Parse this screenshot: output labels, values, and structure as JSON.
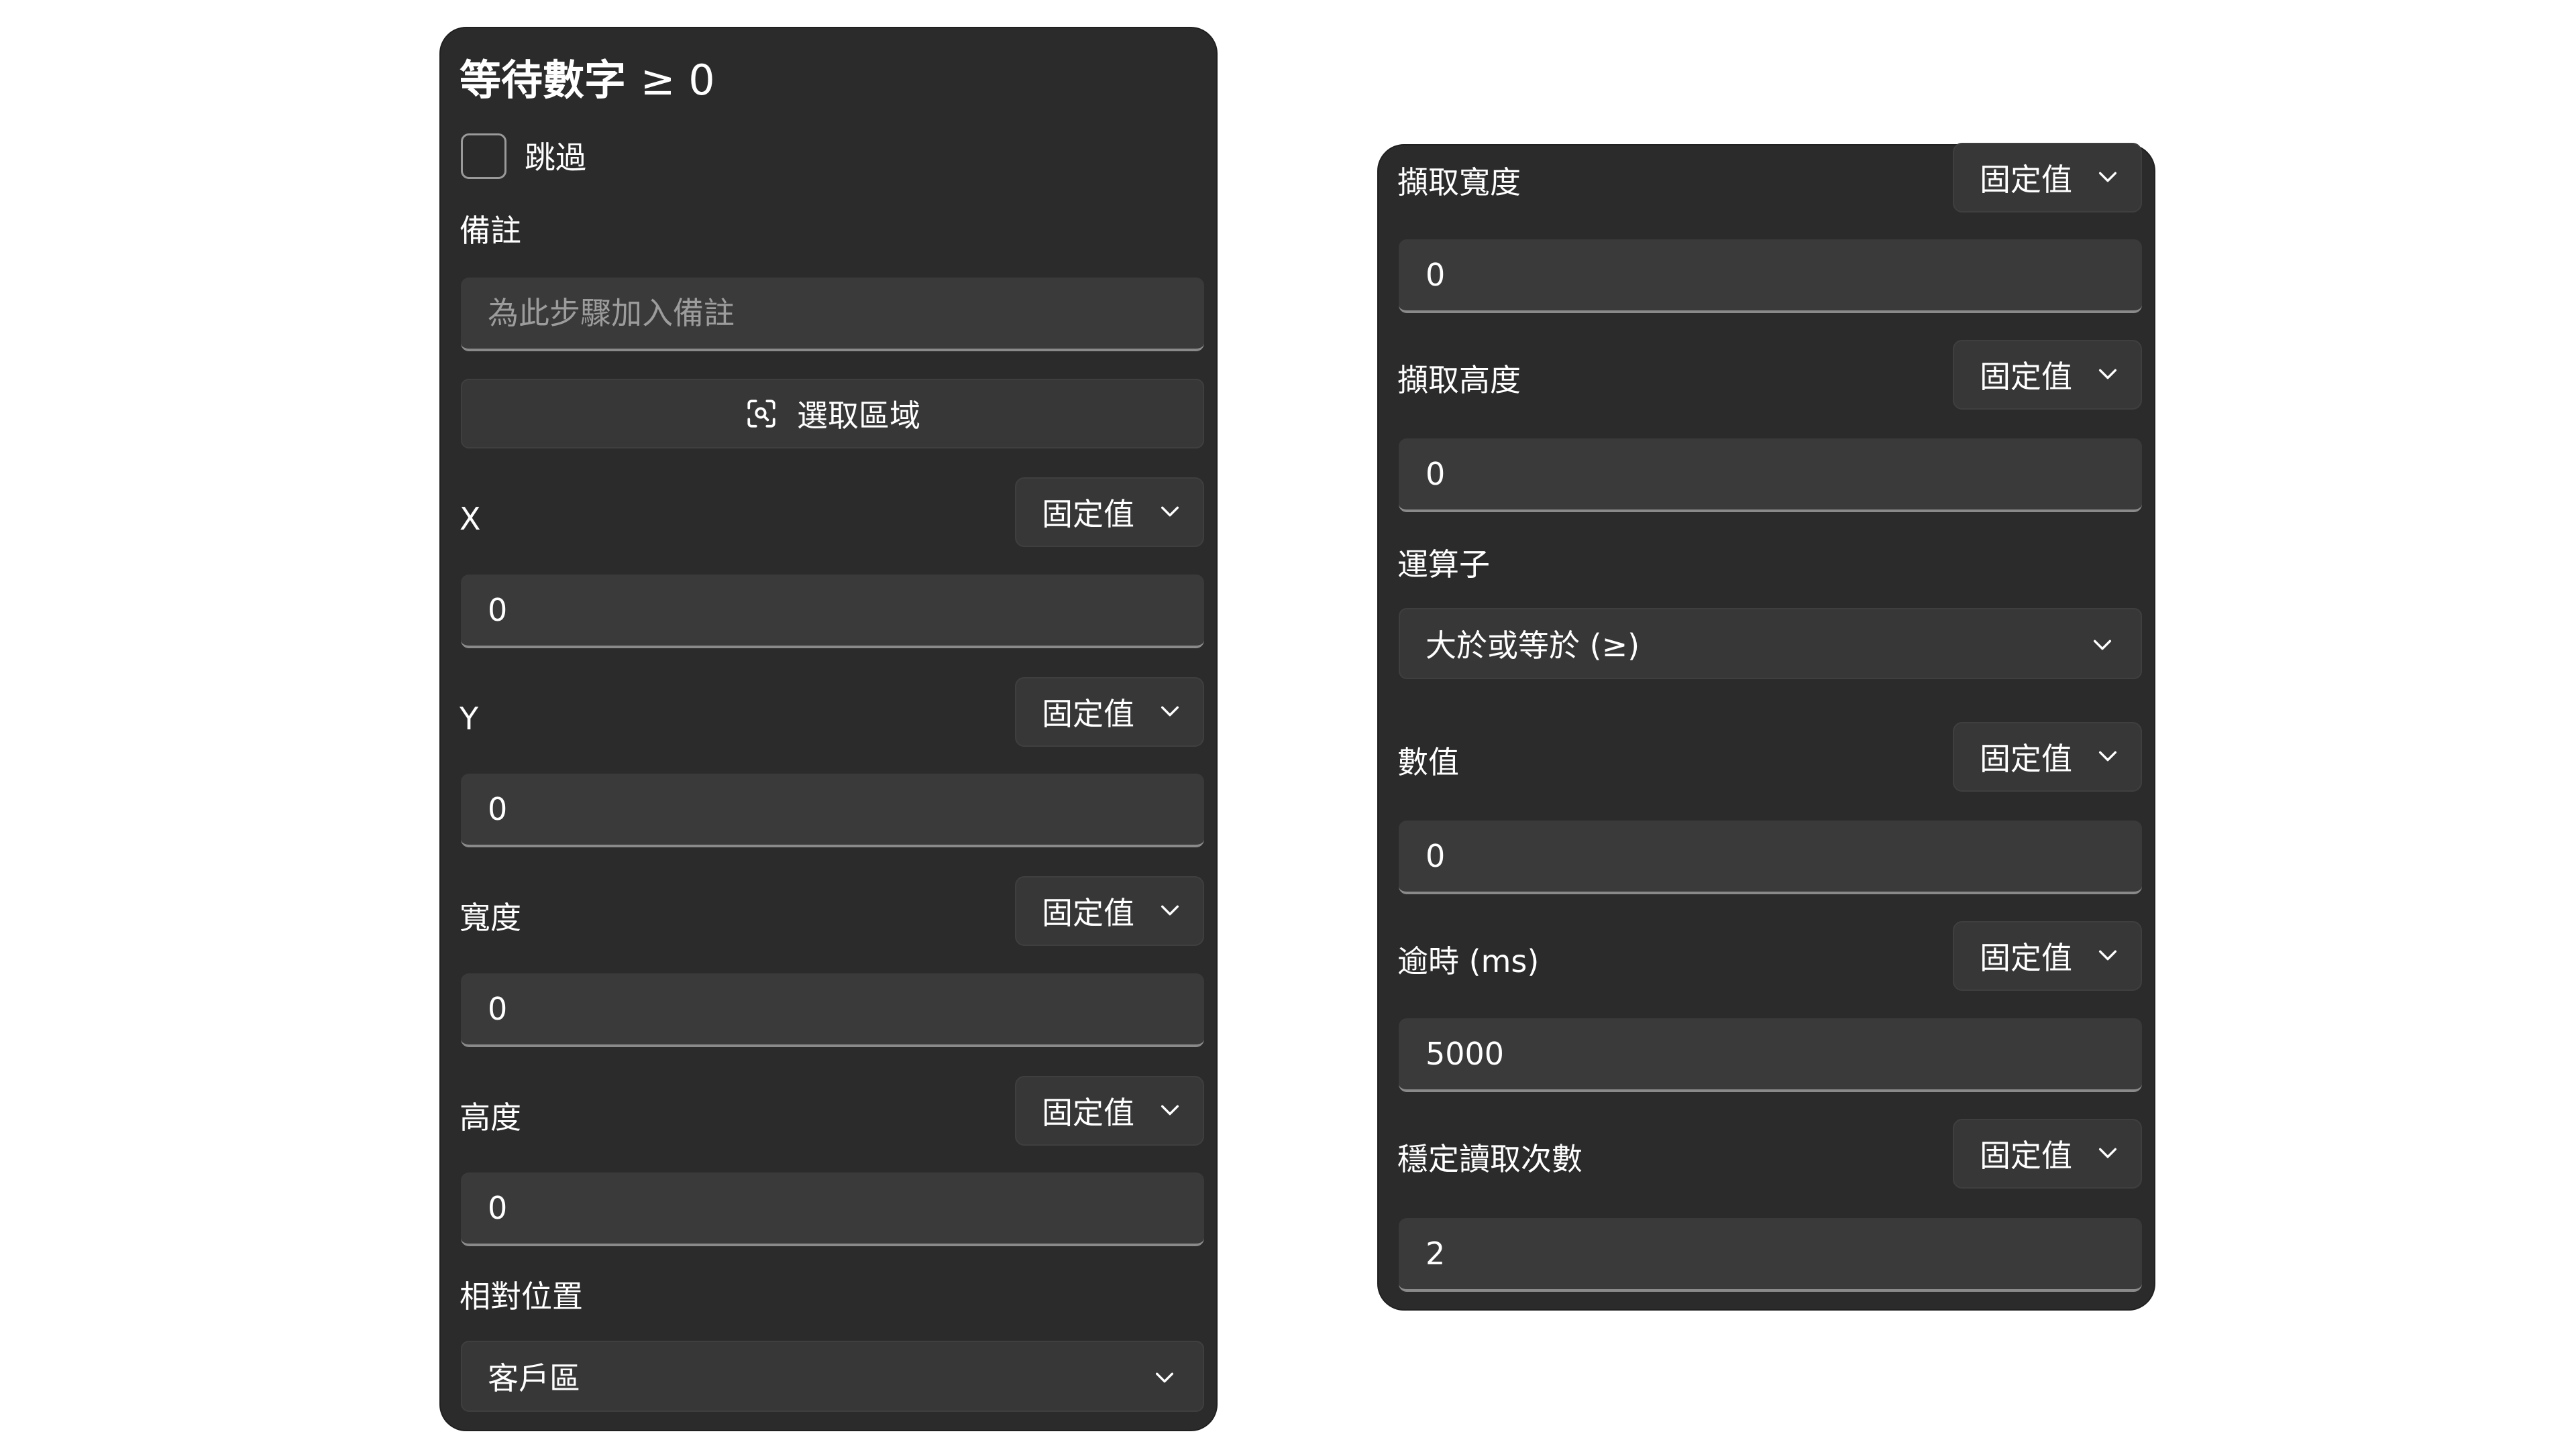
{
  "left_panel": {
    "title": "等待數字",
    "title_op": "≥ 0",
    "skip_label": "跳過",
    "note_label": "備註",
    "note_placeholder": "為此步驟加入備註",
    "select_region_label": "選取區域",
    "fields": [
      {
        "label": "X",
        "mode": "固定值",
        "value": "0"
      },
      {
        "label": "Y",
        "mode": "固定值",
        "value": "0"
      },
      {
        "label": "寬度",
        "mode": "固定值",
        "value": "0"
      },
      {
        "label": "高度",
        "mode": "固定值",
        "value": "0"
      }
    ],
    "relative_label": "相對位置",
    "relative_value": "客戶區"
  },
  "right_panel": {
    "fields_top": [
      {
        "label": "擷取寬度",
        "mode": "固定值",
        "value": "0"
      },
      {
        "label": "擷取高度",
        "mode": "固定值",
        "value": "0"
      }
    ],
    "operator_label": "運算子",
    "operator_value": "大於或等於 (≥)",
    "fields_bottom": [
      {
        "label": "數值",
        "mode": "固定值",
        "value": "0"
      },
      {
        "label": "逾時 (ms)",
        "mode": "固定值",
        "value": "5000"
      },
      {
        "label": "穩定讀取次數",
        "mode": "固定值",
        "value": "2"
      }
    ]
  },
  "colors": {
    "panel_bg": "#2b2b2b",
    "field_bg": "#3a3a3a",
    "text": "#ffffff",
    "placeholder": "#9c9c9c"
  },
  "icons": {
    "select_region": "screen-capture-icon",
    "dropdown": "chevron-down-icon"
  }
}
